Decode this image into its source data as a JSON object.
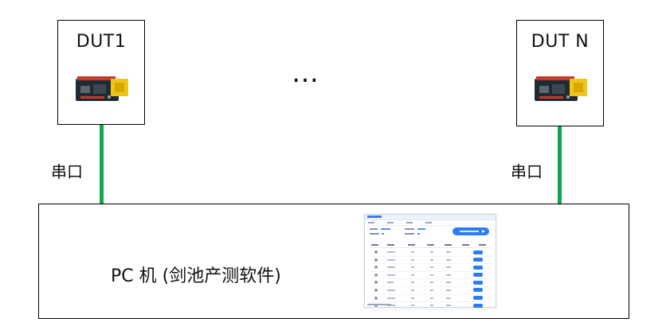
{
  "devices": [
    {
      "label": "DUT1",
      "port": "串口"
    },
    {
      "label": "DUT N",
      "port": "串口"
    }
  ],
  "ellipsis": "…",
  "pc": {
    "label": "PC 机 (剑池产测软件)"
  },
  "colors": {
    "wire": "#11a64a",
    "border": "#000000",
    "accent": "#2f7cf0"
  },
  "icons": [
    "dev-board-icon",
    "software-window-thumbnail"
  ]
}
